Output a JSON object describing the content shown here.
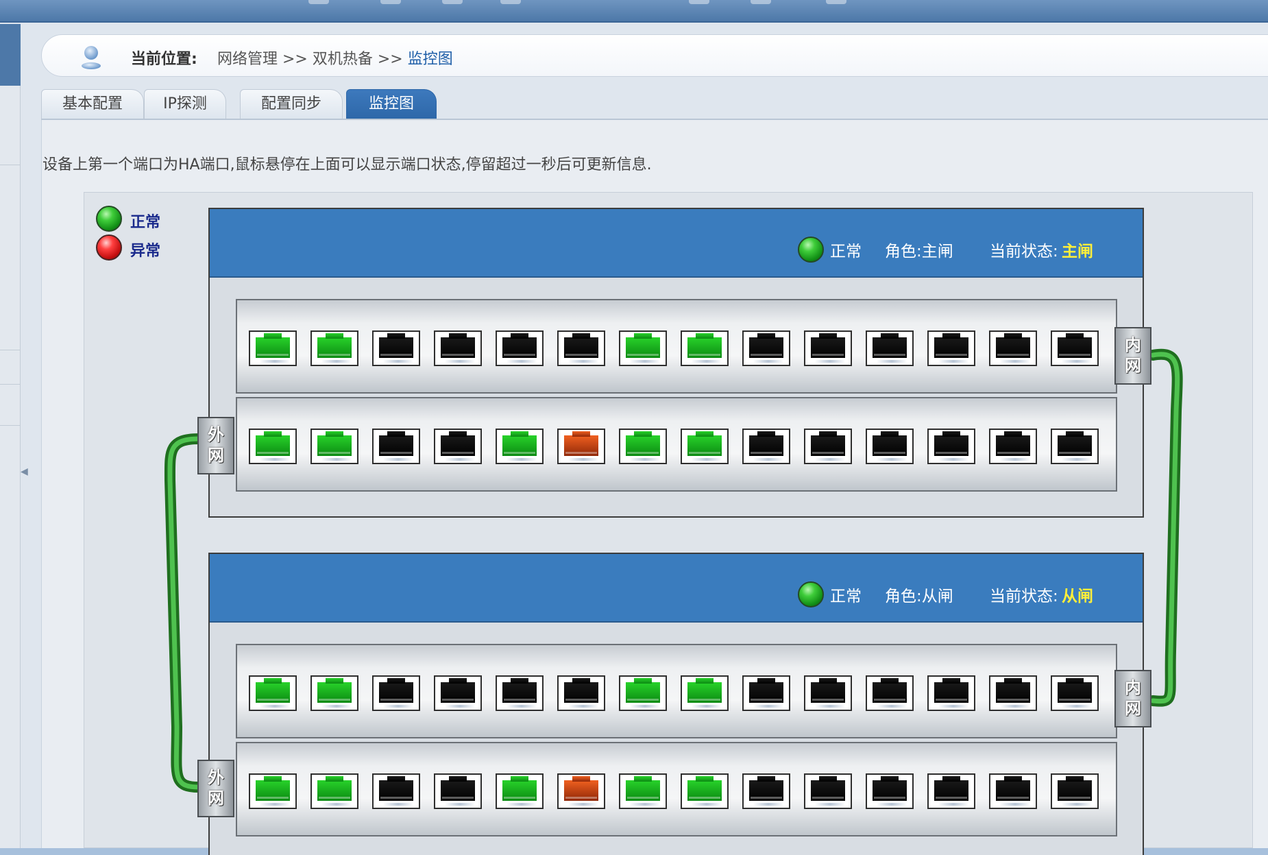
{
  "breadcrumb": {
    "label": "当前位置:",
    "path": "网络管理 >> 双机热备 >> ",
    "current": "监控图"
  },
  "tabs": [
    {
      "label": "基本配置"
    },
    {
      "label": "IP探测"
    },
    {
      "label": "配置同步"
    },
    {
      "label": "监控图",
      "active": true
    }
  ],
  "note": "设备上第一个端口为HA端口,鼠标悬停在上面可以显示端口状态,停留超过一秒后可更新信息.",
  "legend": {
    "normal": "正常",
    "abnormal": "异常"
  },
  "colors": {
    "header_blue": "#3a7cbe",
    "status_yellow": "#ffef3a",
    "port_green": "#1bb31f",
    "port_red": "#d4461a",
    "cable_green": "#2f9a2f"
  },
  "devices": [
    {
      "status": "正常",
      "role": "角色:主闸",
      "state_label": "当前状态:",
      "state_value": "主闸",
      "inner_tag": "内网",
      "outer_tag": "外网",
      "top_ports": [
        "green",
        "green",
        "black",
        "black",
        "black",
        "black",
        "green",
        "green",
        "black",
        "black",
        "black",
        "black",
        "black",
        "black"
      ],
      "bottom_ports": [
        "green",
        "green",
        "black",
        "black",
        "green",
        "red",
        "green",
        "green",
        "black",
        "black",
        "black",
        "black",
        "black",
        "black"
      ]
    },
    {
      "status": "正常",
      "role": "角色:从闸",
      "state_label": "当前状态:",
      "state_value": "从闸",
      "inner_tag": "内网",
      "outer_tag": "外网",
      "top_ports": [
        "green",
        "green",
        "black",
        "black",
        "black",
        "black",
        "green",
        "green",
        "black",
        "black",
        "black",
        "black",
        "black",
        "black"
      ],
      "bottom_ports": [
        "green",
        "green",
        "black",
        "black",
        "green",
        "red",
        "green",
        "green",
        "black",
        "black",
        "black",
        "black",
        "black",
        "black"
      ]
    }
  ]
}
